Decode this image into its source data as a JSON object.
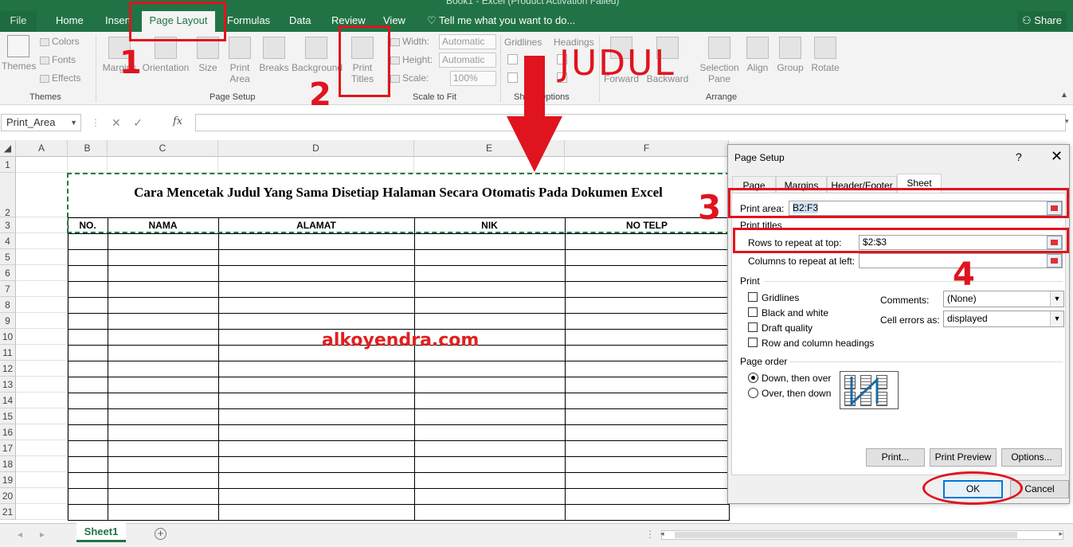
{
  "window": {
    "title": "Book1 - Excel (Product Activation Failed)"
  },
  "tabs": [
    "File",
    "Home",
    "Insert",
    "Page Layout",
    "Formulas",
    "Data",
    "Review",
    "View"
  ],
  "tell_me": "Tell me what you want to do...",
  "share": "Share",
  "ribbon": {
    "themes": "Themes",
    "colors": "Colors",
    "fonts": "Fonts",
    "effects": "Effects",
    "themes_group": "Themes",
    "margins": "Margins",
    "orientation": "Orientation",
    "size": "Size",
    "print_area_1": "Print",
    "print_area_2": "Area",
    "breaks": "Breaks",
    "background": "Background",
    "print_titles_1": "Print",
    "print_titles_2": "Titles",
    "page_setup_group": "Page Setup",
    "width_label": "Width:",
    "width_value": "Automatic",
    "height_label": "Height:",
    "height_value": "Automatic",
    "scale_label": "Scale:",
    "scale_value": "100%",
    "scale_group": "Scale to Fit",
    "gridlines": "Gridlines",
    "headings": "Headings",
    "sheet_options_group": "Sheet Options",
    "bring_forward": "Forward",
    "send_backward": "Backward",
    "selection_pane_1": "Selection",
    "selection_pane_2": "Pane",
    "align": "Align",
    "group": "Group",
    "rotate": "Rotate",
    "arrange_group": "Arrange"
  },
  "formula_bar": {
    "name_box": "Print_Area",
    "formula": ""
  },
  "columns": [
    "A",
    "B",
    "C",
    "D",
    "E",
    "F"
  ],
  "rows": [
    "1",
    "2",
    "3",
    "4",
    "5",
    "6",
    "7",
    "8",
    "9",
    "10",
    "11",
    "12",
    "13",
    "14",
    "15",
    "16",
    "17",
    "18",
    "19",
    "20",
    "21"
  ],
  "sheet": {
    "title": "Cara Mencetak Judul Yang Sama Disetiap Halaman Secara Otomatis Pada Dokumen Excel",
    "headers": [
      "NO.",
      "NAMA",
      "ALAMAT",
      "NIK",
      "NO TELP"
    ],
    "watermark": "alkoyendra.com"
  },
  "sheet_tab": "Sheet1",
  "dialog": {
    "title": "Page Setup",
    "help": "?",
    "close": "✕",
    "tabs": [
      "Page",
      "Margins",
      "Header/Footer",
      "Sheet"
    ],
    "print_area_label": "Print area:",
    "print_area_value": "B2:F3",
    "print_titles_label": "Print titles",
    "rows_label": "Rows to repeat at top:",
    "rows_value": "$2:$3",
    "cols_label": "Columns to repeat at left:",
    "cols_value": "",
    "print_label": "Print",
    "gridlines": "Gridlines",
    "black_white": "Black and white",
    "draft": "Draft quality",
    "row_col_headings": "Row and column headings",
    "comments_label": "Comments:",
    "comments_value": "(None)",
    "errors_label": "Cell errors as:",
    "errors_value": "displayed",
    "page_order_label": "Page order",
    "down_then_over": "Down, then over",
    "over_then_down": "Over, then down",
    "print_btn": "Print...",
    "preview_btn": "Print Preview",
    "options_btn": "Options...",
    "ok_btn": "OK",
    "cancel_btn": "Cancel"
  },
  "annotations": {
    "n1": "1",
    "n2": "2",
    "n3": "3",
    "n4": "4",
    "judul": "JUDUL"
  },
  "colors": {
    "excel_green": "#217346",
    "annotation_red": "#e0141e",
    "print_area_dash": "#1e7a45"
  }
}
